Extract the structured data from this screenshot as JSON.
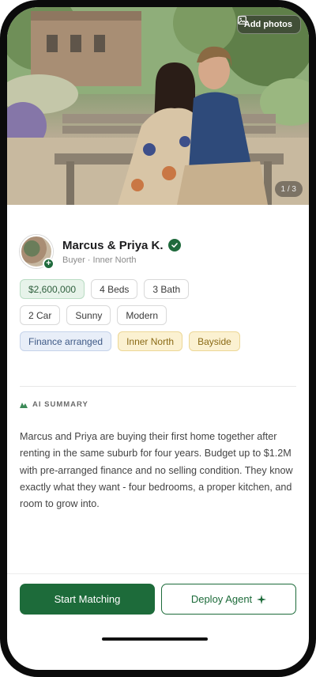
{
  "photo": {
    "add_photos_label": "Add photos",
    "counter": "1 / 3"
  },
  "profile": {
    "name": "Marcus & Priya K.",
    "subtitle": "Buyer · Inner North"
  },
  "chips": {
    "row1": [
      "$2,600,000",
      "4 Beds",
      "3 Bath"
    ],
    "row2": [
      "2 Car",
      "Sunny",
      "Modern"
    ],
    "row3": [
      "Finance arranged",
      "Inner North",
      "Bayside"
    ]
  },
  "ai_summary": {
    "label": "AI SUMMARY",
    "text": "Marcus and Priya are buying their first home together after renting in the same suburb for four years. Budget up to $1.2M with pre-arranged finance and no selling condition. They know exactly what they want - four bedrooms, a proper kitchen, and room to grow into."
  },
  "actions": {
    "primary_label": "Start Matching",
    "secondary_label": "Deploy Agent"
  },
  "colors": {
    "brand_green": "#1d6b3a",
    "price_chip_bg": "#e7f3ea",
    "finance_chip_bg": "#e8eef8",
    "area_chip_bg": "#fbf1d1"
  },
  "icons": [
    "image-icon",
    "verified-check-icon",
    "plus-icon",
    "ai-sparkle-icon",
    "sparkle-icon"
  ]
}
